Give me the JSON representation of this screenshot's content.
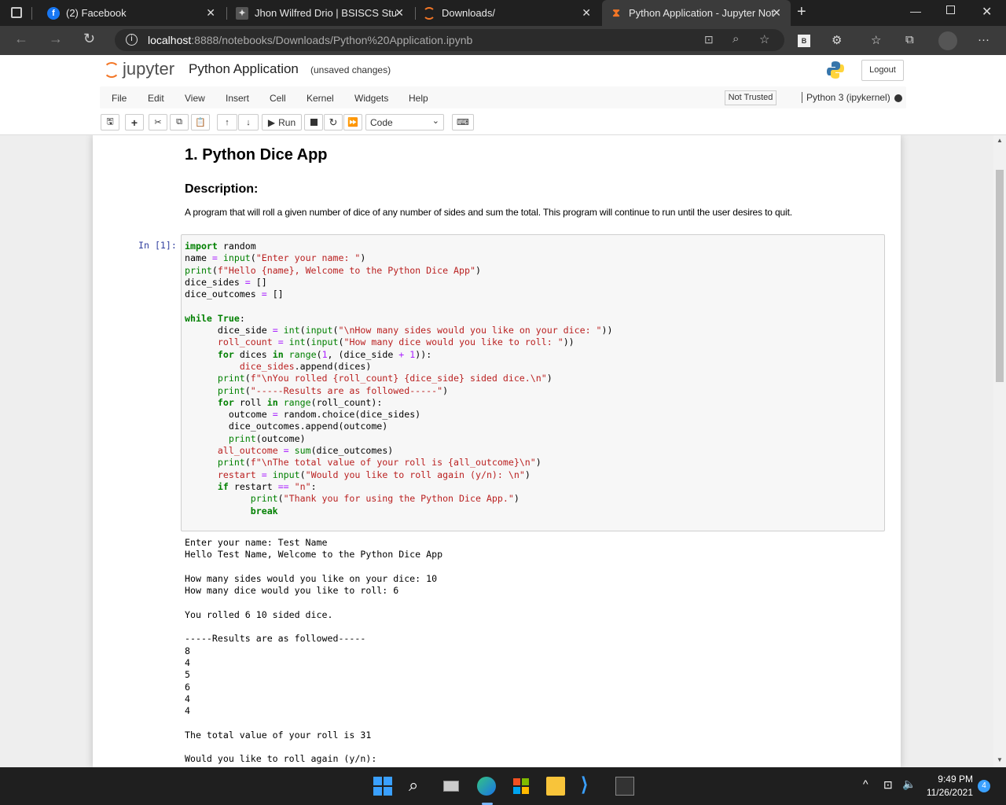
{
  "browser": {
    "tabs": [
      {
        "label": "(2) Facebook",
        "icon": "facebook-icon"
      },
      {
        "label": "Jhon Wilfred Drio | BSISCS Stude",
        "icon": "profile-icon"
      },
      {
        "label": "Downloads/",
        "icon": "jupyter-icon"
      },
      {
        "label": "Python Application - Jupyter Not",
        "icon": "hourglass-icon"
      }
    ],
    "url_host": "localhost",
    "url_path": ":8888/notebooks/Downloads/Python%20Application.ipynb",
    "profile_badge": "B"
  },
  "jupyter": {
    "logo_text": "jupyter",
    "notebook_name": "Python Application",
    "save_status": "(unsaved changes)",
    "logout_label": "Logout",
    "menus": [
      "File",
      "Edit",
      "View",
      "Insert",
      "Cell",
      "Kernel",
      "Widgets",
      "Help"
    ],
    "trust_label": "Not Trusted",
    "kernel_label": "Python 3 (ipykernel)",
    "run_label": "Run",
    "cell_type": "Code"
  },
  "notebook": {
    "title": "1. Python Dice App",
    "desc_heading": "Description:",
    "desc_text": "A program that will roll a given number of dice of any number of sides and sum the total. This program will continue to run until the user desires to quit.",
    "prompt": "In [1]:",
    "output": "Enter your name: Test Name\nHello Test Name, Welcome to the Python Dice App\n\nHow many sides would you like on your dice: 10\nHow many dice would you like to roll: 6\n\nYou rolled 6 10 sided dice.\n\n-----Results are as followed-----\n8\n4\n5\n6\n4\n4\n\nThe total value of your roll is 31\n\nWould you like to roll again (y/n):"
  },
  "taskbar": {
    "time": "9:49 PM",
    "date": "11/26/2021",
    "notification_count": "4"
  },
  "colors": {
    "accent": "#f37626",
    "kw": "#008000",
    "string": "#ba2121"
  }
}
